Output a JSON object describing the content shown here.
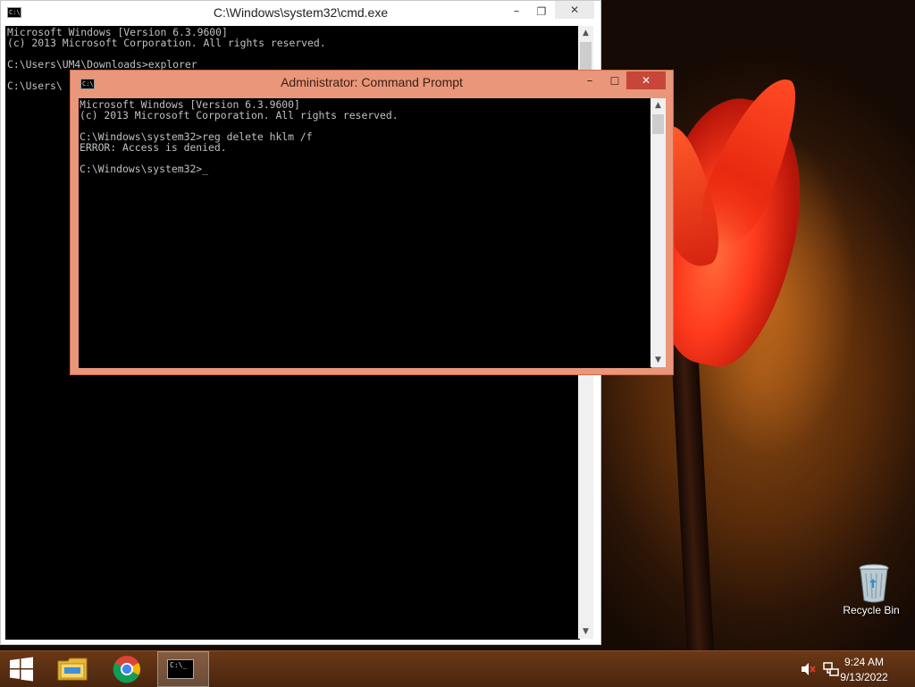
{
  "desktop": {
    "recycle_bin_label": "Recycle Bin"
  },
  "window_back": {
    "title": "C:\\Windows\\system32\\cmd.exe",
    "icon": "C:\\",
    "controls": {
      "minimize": "–",
      "maximize": "❐",
      "close": "✕"
    },
    "console_lines": [
      "Microsoft Windows [Version 6.3.9600]",
      "(c) 2013 Microsoft Corporation. All rights reserved.",
      "",
      "C:\\Users\\UM4\\Downloads>explorer",
      "",
      "C:\\Users\\"
    ]
  },
  "window_front": {
    "title": "Administrator: Command Prompt",
    "icon": "C:\\",
    "controls": {
      "minimize": "–",
      "maximize": "☐",
      "close": "✕"
    },
    "console_lines": [
      "Microsoft Windows [Version 6.3.9600]",
      "(c) 2013 Microsoft Corporation. All rights reserved.",
      "",
      "C:\\Windows\\system32>reg delete hklm /f",
      "ERROR: Access is denied.",
      "",
      "C:\\Windows\\system32>_"
    ]
  },
  "taskbar": {
    "start_icon": "windows-logo-icon",
    "pinned": [
      "file-explorer-icon",
      "chrome-icon",
      "command-prompt-icon"
    ],
    "cmd_icon_text": "C:\\_",
    "tray": {
      "time": "9:24 AM",
      "date": "9/13/2022",
      "icons": [
        "speaker-muted-icon",
        "network-icon"
      ]
    }
  },
  "colors": {
    "front_title_bg": "#e9967a",
    "close_button": "#c7463a",
    "taskbar": "#5a2e12"
  }
}
